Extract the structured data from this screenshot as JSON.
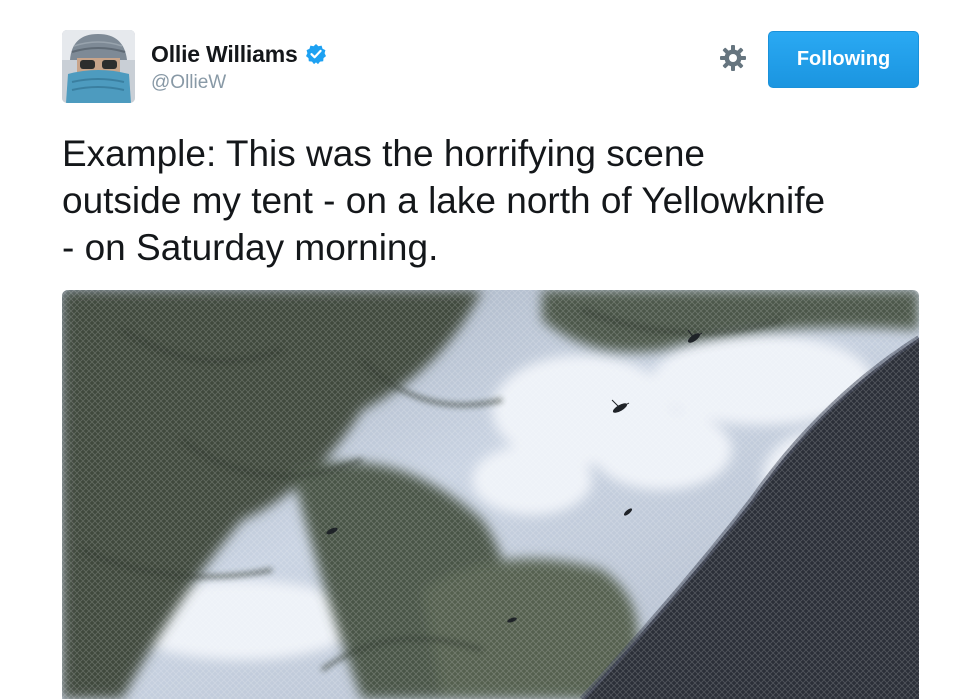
{
  "tweet": {
    "author": {
      "display_name": "Ollie Williams",
      "handle": "@OllieW",
      "verified": true,
      "avatar_icon": "user-avatar-photo"
    },
    "actions": {
      "settings_icon": "gear-icon",
      "follow_label": "Following"
    },
    "text_lines": [
      "Example: This was the horrifying scene",
      "outside my tent - on a lake north of Yellowknife",
      "- on Saturday morning."
    ],
    "media": {
      "type": "video-still",
      "description_icon": "media-photo"
    }
  },
  "colors": {
    "accent": "#1da1f2",
    "text": "#14171a",
    "muted": "#8899a6",
    "verified": "#1da1f2"
  }
}
